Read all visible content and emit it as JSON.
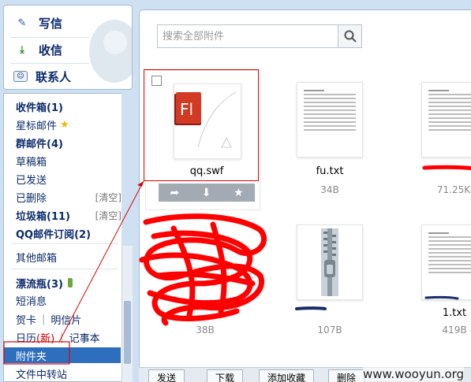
{
  "quick_actions": [
    {
      "label": "写信",
      "icon": "pencil-icon"
    },
    {
      "label": "收信",
      "icon": "inbox-download-icon"
    },
    {
      "label": "联系人",
      "icon": "contact-card-icon"
    }
  ],
  "folders": {
    "inbox": "收件箱(1)",
    "starred": "星标邮件",
    "group": "群邮件(4)",
    "drafts": "草稿箱",
    "sent": "已发送",
    "deleted": "已删除",
    "clear_label": "[清空]",
    "spam": "垃圾箱(11)",
    "subscriptions": "QQ邮件订阅(2)",
    "other": "其他邮箱",
    "drift": "漂流瓶(3)",
    "sms": "短消息",
    "card": "贺卡",
    "postcard": "明信片",
    "calendar": "日历",
    "calendar_new": "(新)",
    "notes": "记事本",
    "attachments": "附件夹",
    "transfer": "文件中转站"
  },
  "search": {
    "placeholder": "搜索全部附件"
  },
  "files": [
    {
      "name": "qq.swf",
      "size": "",
      "type": "flash"
    },
    {
      "name": "fu.txt",
      "size": "34B",
      "type": "text"
    },
    {
      "name": "",
      "size": "71.25K",
      "type": "text"
    },
    {
      "name": "",
      "size": "38B",
      "type": "image"
    },
    {
      "name": "",
      "size": "107B",
      "type": "zip"
    },
    {
      "name": "1.txt",
      "size": "419B",
      "type": "text"
    }
  ],
  "toolbar": {
    "send": "发送",
    "download": "下载",
    "favorite": "添加收藏",
    "delete": "删除"
  },
  "watermark": "www.wooyun.org"
}
